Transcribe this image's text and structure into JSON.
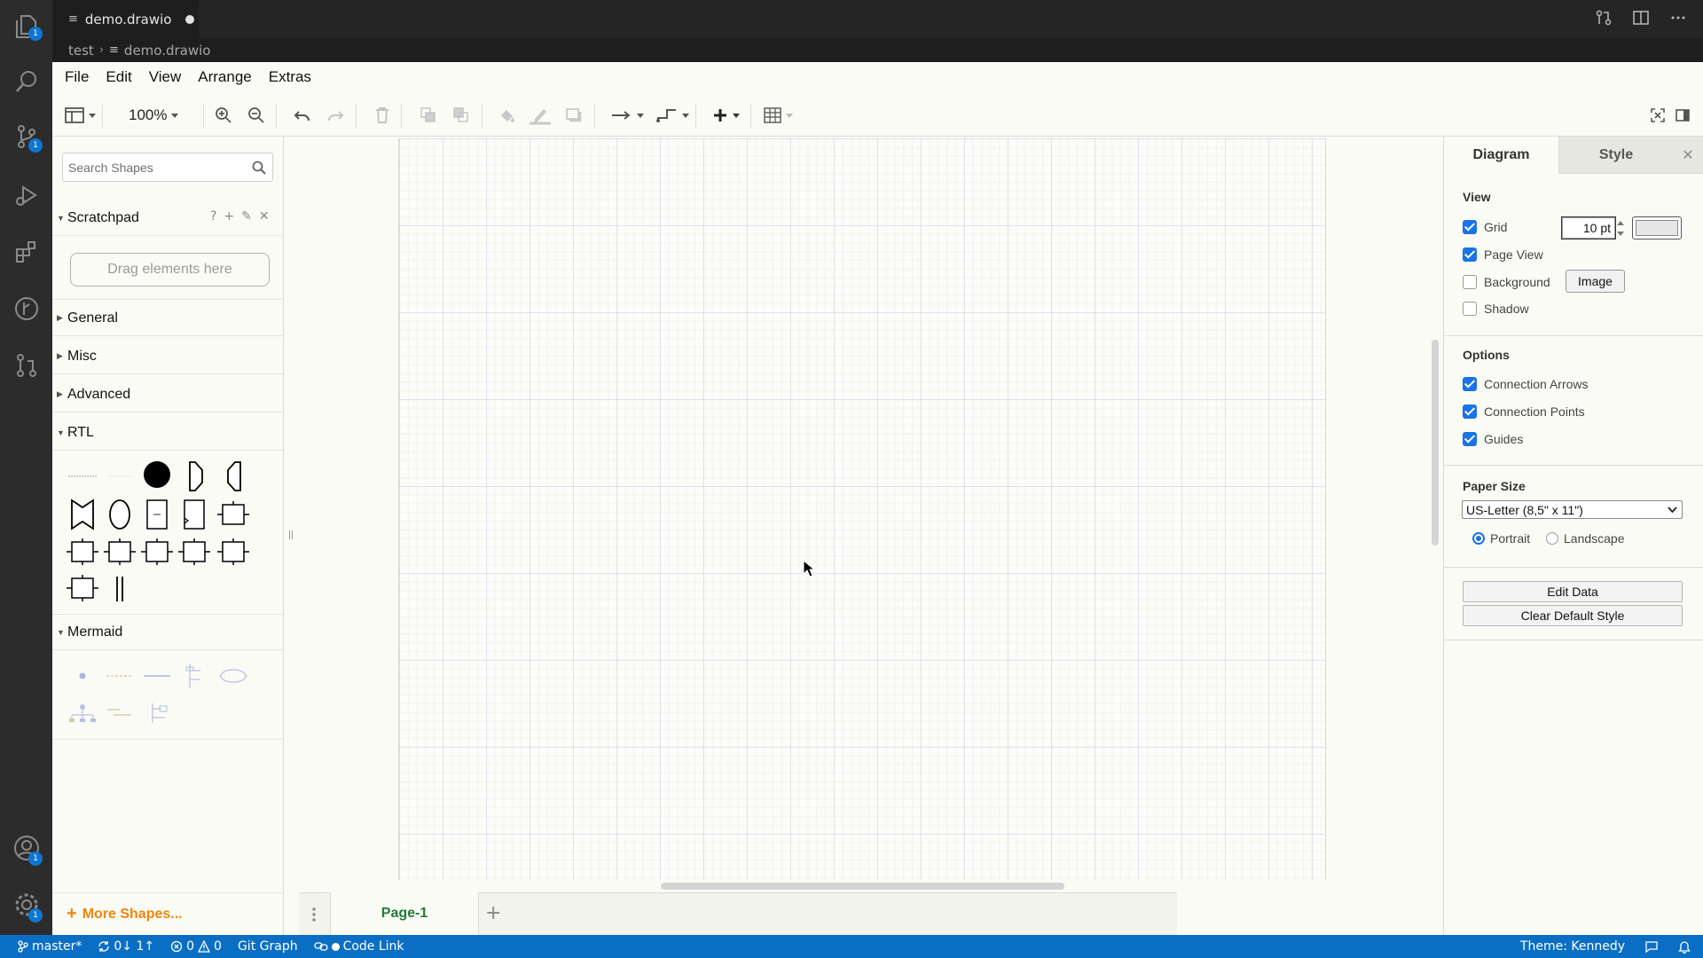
{
  "app": {
    "tab_title": "demo.drawio",
    "breadcrumb": [
      "test",
      "demo.drawio"
    ]
  },
  "activity_bar": {
    "badges": {
      "explorer": "1",
      "source_control": "1",
      "accounts": "1",
      "manage": "1"
    }
  },
  "menu": [
    "File",
    "Edit",
    "View",
    "Arrange",
    "Extras"
  ],
  "toolbar": {
    "zoom": "100%"
  },
  "sidebar": {
    "search_placeholder": "Search Shapes",
    "scratchpad": {
      "title": "Scratchpad",
      "drop_hint": "Drag elements here",
      "tools": [
        "?",
        "+",
        "✎",
        "✕"
      ]
    },
    "sections": [
      "General",
      "Misc",
      "Advanced",
      "RTL",
      "Mermaid"
    ],
    "more_shapes": "More Shapes..."
  },
  "pages": {
    "add_symbol": "+",
    "tabs": [
      "Page-1"
    ]
  },
  "format_panel": {
    "tabs": [
      "Diagram",
      "Style"
    ],
    "close_symbol": "✕",
    "view": {
      "title": "View",
      "grid": {
        "label": "Grid",
        "checked": true,
        "size": "10 pt"
      },
      "page_view": {
        "label": "Page View",
        "checked": true
      },
      "background": {
        "label": "Background",
        "checked": false,
        "button": "Image"
      },
      "shadow": {
        "label": "Shadow",
        "checked": false
      }
    },
    "options": {
      "title": "Options",
      "connection_arrows": {
        "label": "Connection Arrows",
        "checked": true
      },
      "connection_points": {
        "label": "Connection Points",
        "checked": true
      },
      "guides": {
        "label": "Guides",
        "checked": true
      }
    },
    "paper": {
      "title": "Paper Size",
      "selected": "US-Letter (8,5\" x 11\")",
      "portrait": {
        "label": "Portrait",
        "checked": true
      },
      "landscape": {
        "label": "Landscape",
        "checked": false
      }
    },
    "buttons": {
      "edit_data": "Edit Data",
      "clear_style": "Clear Default Style"
    }
  },
  "status_bar": {
    "branch": "master*",
    "sync": "0↓ 1↑",
    "errors": "0",
    "warnings": "0",
    "git_graph": "Git Graph",
    "code_link": "Code Link",
    "theme": "Theme: Kennedy"
  },
  "colors": {
    "status_bar": "#0a6fc4",
    "accent": "#1a73e8",
    "more_shapes": "#f08705",
    "page_tab": "#1f7a3a"
  }
}
